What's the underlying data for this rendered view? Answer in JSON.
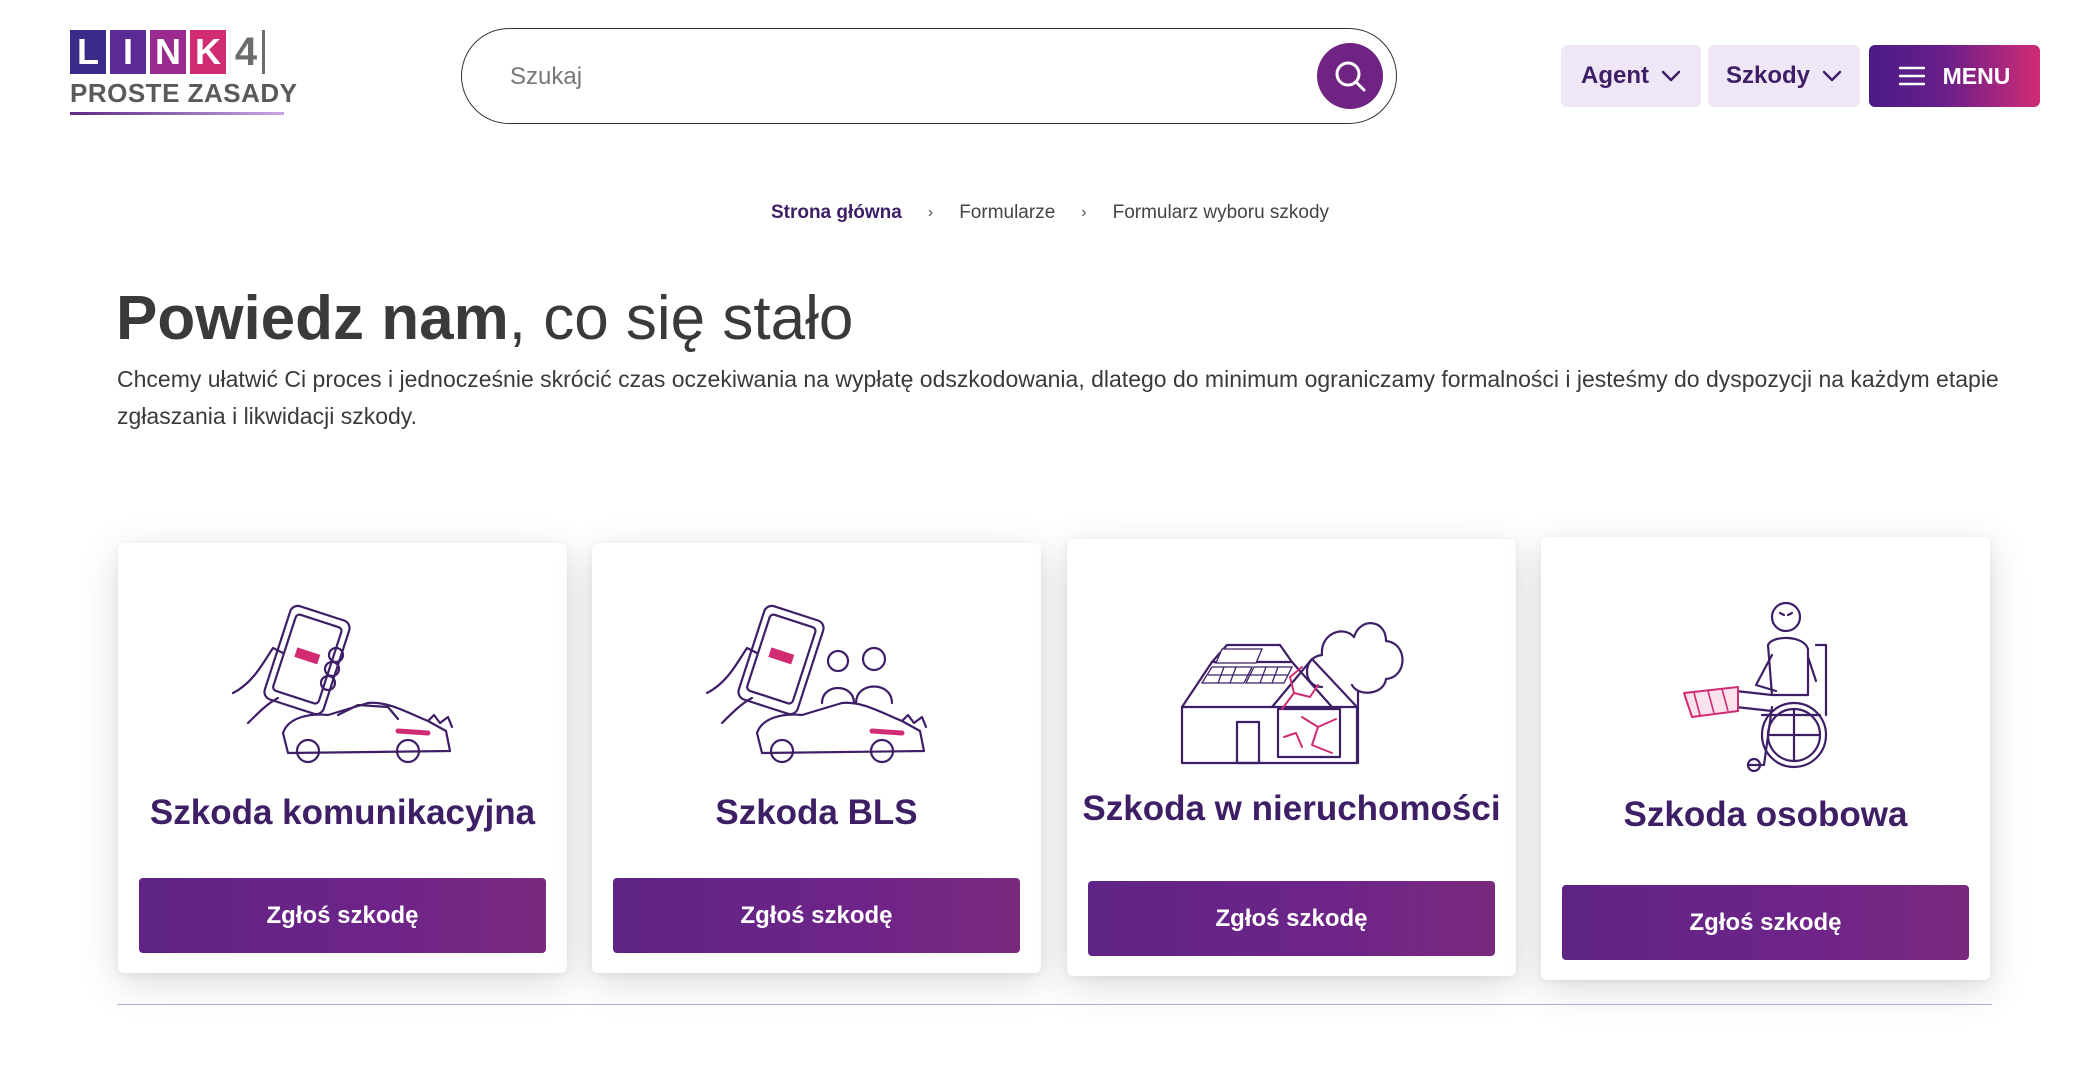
{
  "logo": {
    "letters": [
      "L",
      "I",
      "N",
      "K"
    ],
    "digit": "4",
    "tagline": "PROSTE ZASADY",
    "colors": [
      "#3b2a87",
      "#5b2a95",
      "#9b2a8f",
      "#d12b74"
    ]
  },
  "search": {
    "placeholder": "Szukaj",
    "value": ""
  },
  "nav": {
    "agent_label": "Agent",
    "szkody_label": "Szkody",
    "menu_label": "MENU"
  },
  "breadcrumb": [
    "Strona główna",
    "Formularze",
    "Formularz wyboru szkody"
  ],
  "hero": {
    "title_bold": "Powiedz nam",
    "title_light": ", co się stało",
    "description": "Chcemy ułatwić Ci proces i jednocześnie skrócić czas oczekiwania na wypłatę odszkodowania, dlatego do minimum ograniczamy formalności i jesteśmy do dyspozycji na każdym etapie zgłaszania i likwidacji szkody."
  },
  "cards": [
    {
      "title": "Szkoda komunikacyjna",
      "button": "Zgłoś szkodę",
      "illustration": "phone-car-crash-icon"
    },
    {
      "title": "Szkoda BLS",
      "button": "Zgłoś szkodę",
      "illustration": "phone-car-people-icon"
    },
    {
      "title": "Szkoda w nieruchomości",
      "button": "Zgłoś szkodę",
      "illustration": "damaged-house-icon"
    },
    {
      "title": "Szkoda osobowa",
      "button": "Zgłoś szkodę",
      "illustration": "wheelchair-person-icon"
    }
  ],
  "colors": {
    "brand_purple": "#3e1f66",
    "button_purple": "#6e2488",
    "accent_pink": "#d12b74",
    "pill_bg": "#efe6f6"
  }
}
